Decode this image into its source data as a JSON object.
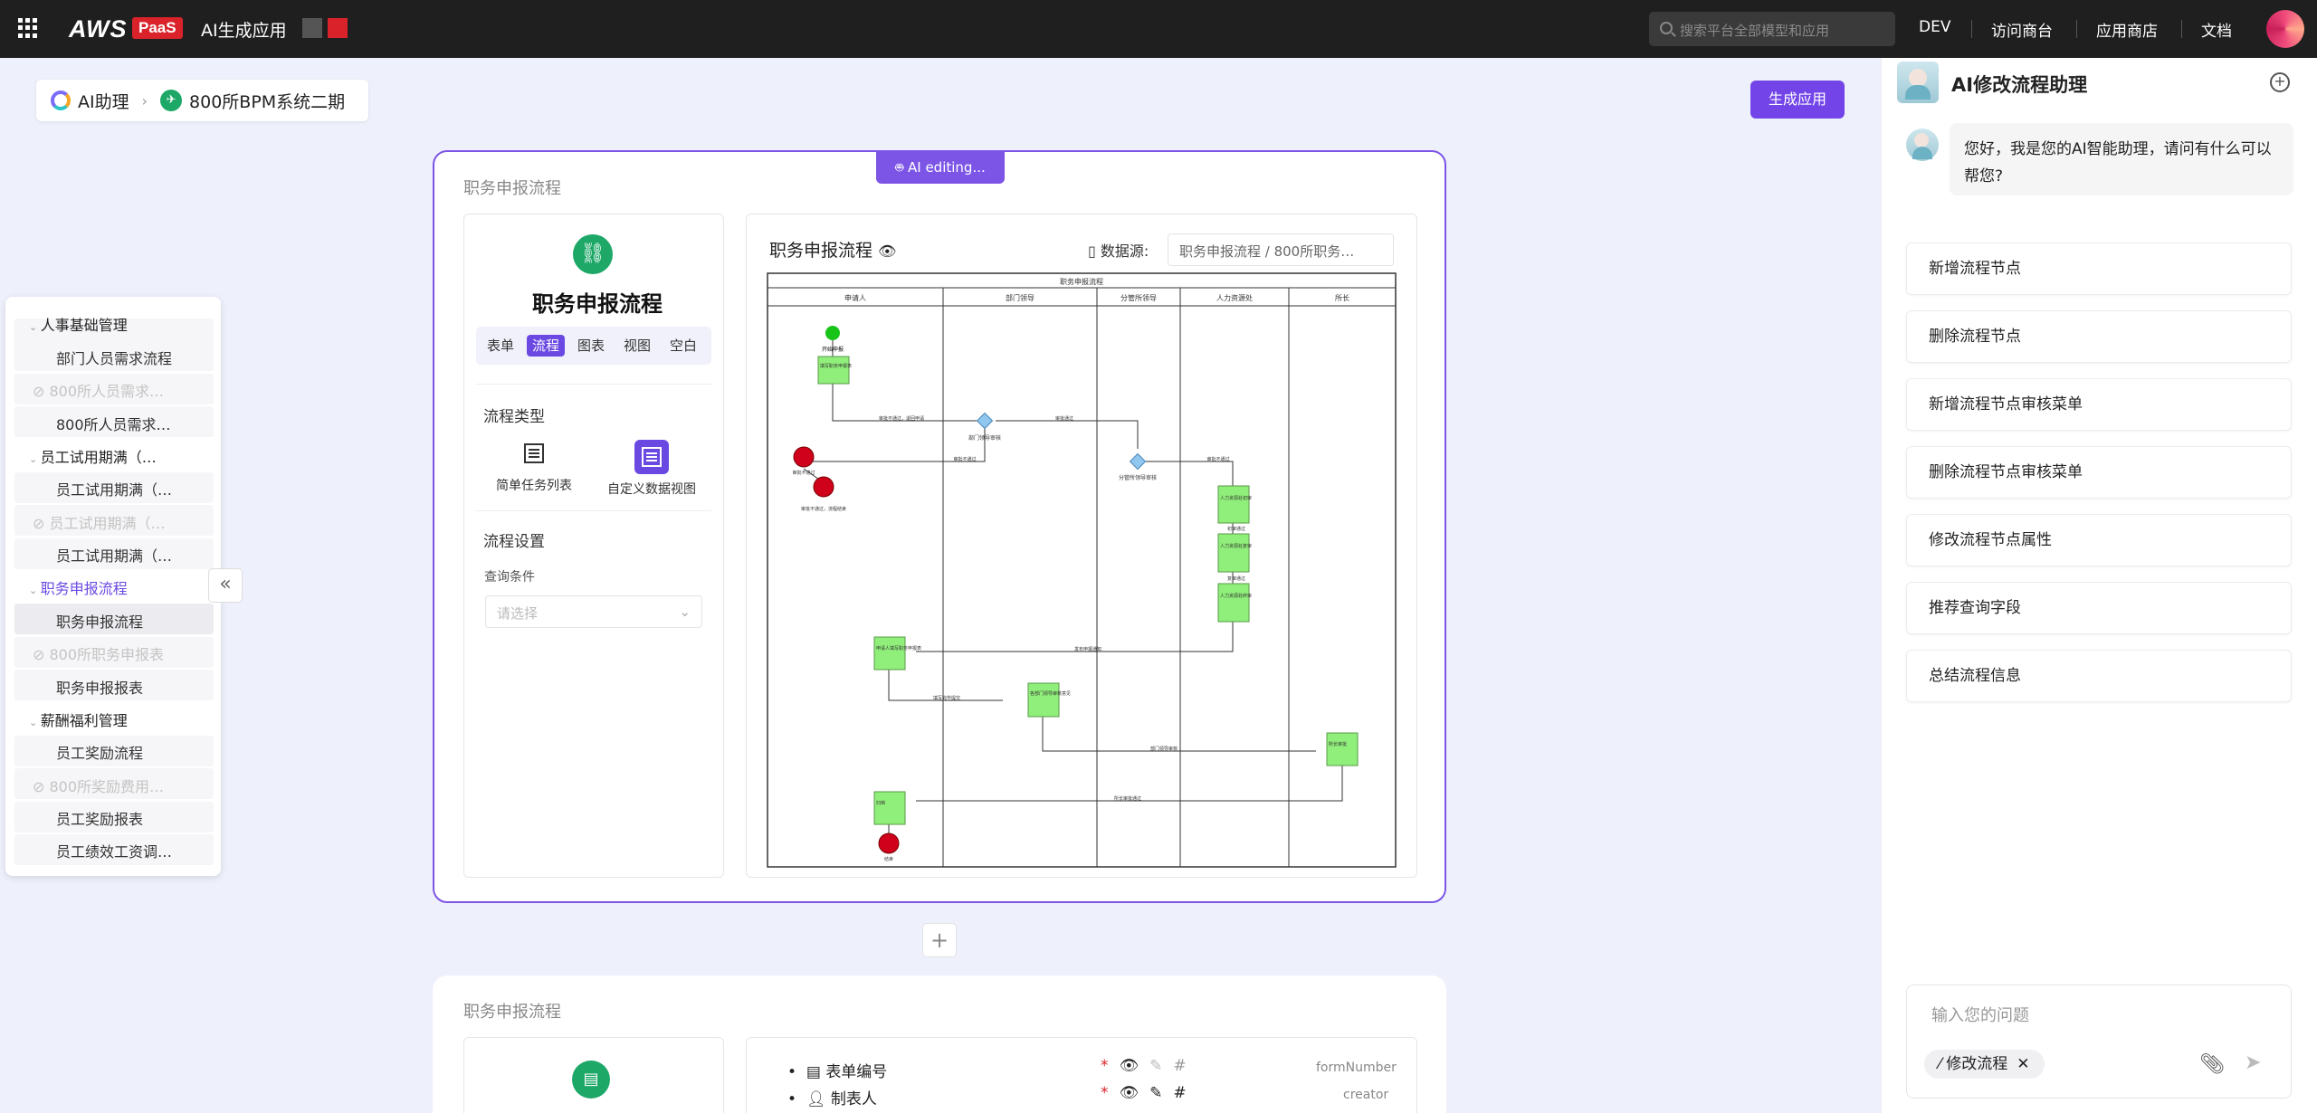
{
  "topbar": {
    "logo": "AWS",
    "logo_badge": "PaaS",
    "app_title": "AI生成应用",
    "search_placeholder": "搜索平台全部模型和应用",
    "nav": [
      "DEV",
      "访问商台",
      "应用商店",
      "文档"
    ]
  },
  "breadcrumb": {
    "item1": "AI助理",
    "item2": "800所BPM系统二期"
  },
  "generate_button": "生成应用",
  "card1": {
    "ai_editing_label": "AI editing...",
    "title": "职务申报流程",
    "left": {
      "name": "职务申报流程",
      "tabs": [
        "表单",
        "流程",
        "图表",
        "视图",
        "空白"
      ],
      "active_tab": 1,
      "flow_type_heading": "流程类型",
      "types": [
        "简单任务列表",
        "自定义数据视图"
      ],
      "flow_settings_heading": "流程设置",
      "query_label": "查询条件",
      "query_placeholder": "请选择"
    },
    "right": {
      "diagram_title": "职务申报流程",
      "datasource_label": "数据源:",
      "datasource_value": "职务申报流程 / 800所职务…",
      "diagram": {
        "pool_title": "职务申报流程",
        "lanes": [
          "申请人",
          "部门领导",
          "分管所领导",
          "人力资源处",
          "所长"
        ],
        "tasks": [
          "填写职务申报表",
          "人力资源处初审",
          "人力资源处复审",
          "人力资源处终审",
          "申请人填写职务申报表",
          "各部门领导审核意见",
          "所长审批",
          "归档"
        ],
        "gateways": [
          "部门领导审核",
          "分管所领导审核"
        ],
        "start": "开始申报",
        "ends": [
          "审批不通过",
          "审批不通过，流程结束",
          "结束"
        ],
        "edge_labels": [
          "审批不通过，退回申请",
          "审批通过",
          "审批不通过",
          "审批不通过",
          "初审通过",
          "复审通过",
          "发布申报通知",
          "填写完毕提交",
          "部门领导审核",
          "所长审批通过"
        ]
      }
    }
  },
  "add_button": "+",
  "card2": {
    "title": "职务申报流程",
    "fields": [
      {
        "label": "表单编号",
        "key": "formNumber"
      },
      {
        "label": "制表人",
        "key": "creator"
      }
    ]
  },
  "sidebar": {
    "items": [
      {
        "type": "group",
        "label": "人事基础管理"
      },
      {
        "type": "child",
        "label": "部门人员需求流程"
      },
      {
        "type": "hidden",
        "label": "800所人员需求…"
      },
      {
        "type": "child",
        "label": "800所人员需求…"
      },
      {
        "type": "group",
        "label": "员工试用期满（…"
      },
      {
        "type": "child",
        "label": "员工试用期满（…"
      },
      {
        "type": "hidden",
        "label": "员工试用期满（…"
      },
      {
        "type": "child",
        "label": "员工试用期满（…"
      },
      {
        "type": "group-active",
        "label": "职务申报流程"
      },
      {
        "type": "child-selected",
        "label": "职务申报流程"
      },
      {
        "type": "hidden",
        "label": "800所职务申报表"
      },
      {
        "type": "child",
        "label": "职务申报报表"
      },
      {
        "type": "group",
        "label": "薪酬福利管理"
      },
      {
        "type": "child",
        "label": "员工奖励流程"
      },
      {
        "type": "hidden",
        "label": "800所奖励费用…"
      },
      {
        "type": "child",
        "label": "员工奖励报表"
      },
      {
        "type": "child",
        "label": "员工绩效工资调…"
      }
    ]
  },
  "chat": {
    "title": "AI修改流程助理",
    "greeting": "您好，我是您的AI智能助理，请问有什么可以帮您?",
    "actions": [
      "新增流程节点",
      "删除流程节点",
      "新增流程节点审核菜单",
      "删除流程节点审核菜单",
      "修改流程节点属性",
      "推荐查询字段",
      "总结流程信息"
    ],
    "input_placeholder": "输入您的问题",
    "mode_tag": "修改流程"
  },
  "colors": {
    "accent": "#7c55e6",
    "brand_red": "#d9222a",
    "green": "#1ea868",
    "task_green": "#90ee7a"
  }
}
